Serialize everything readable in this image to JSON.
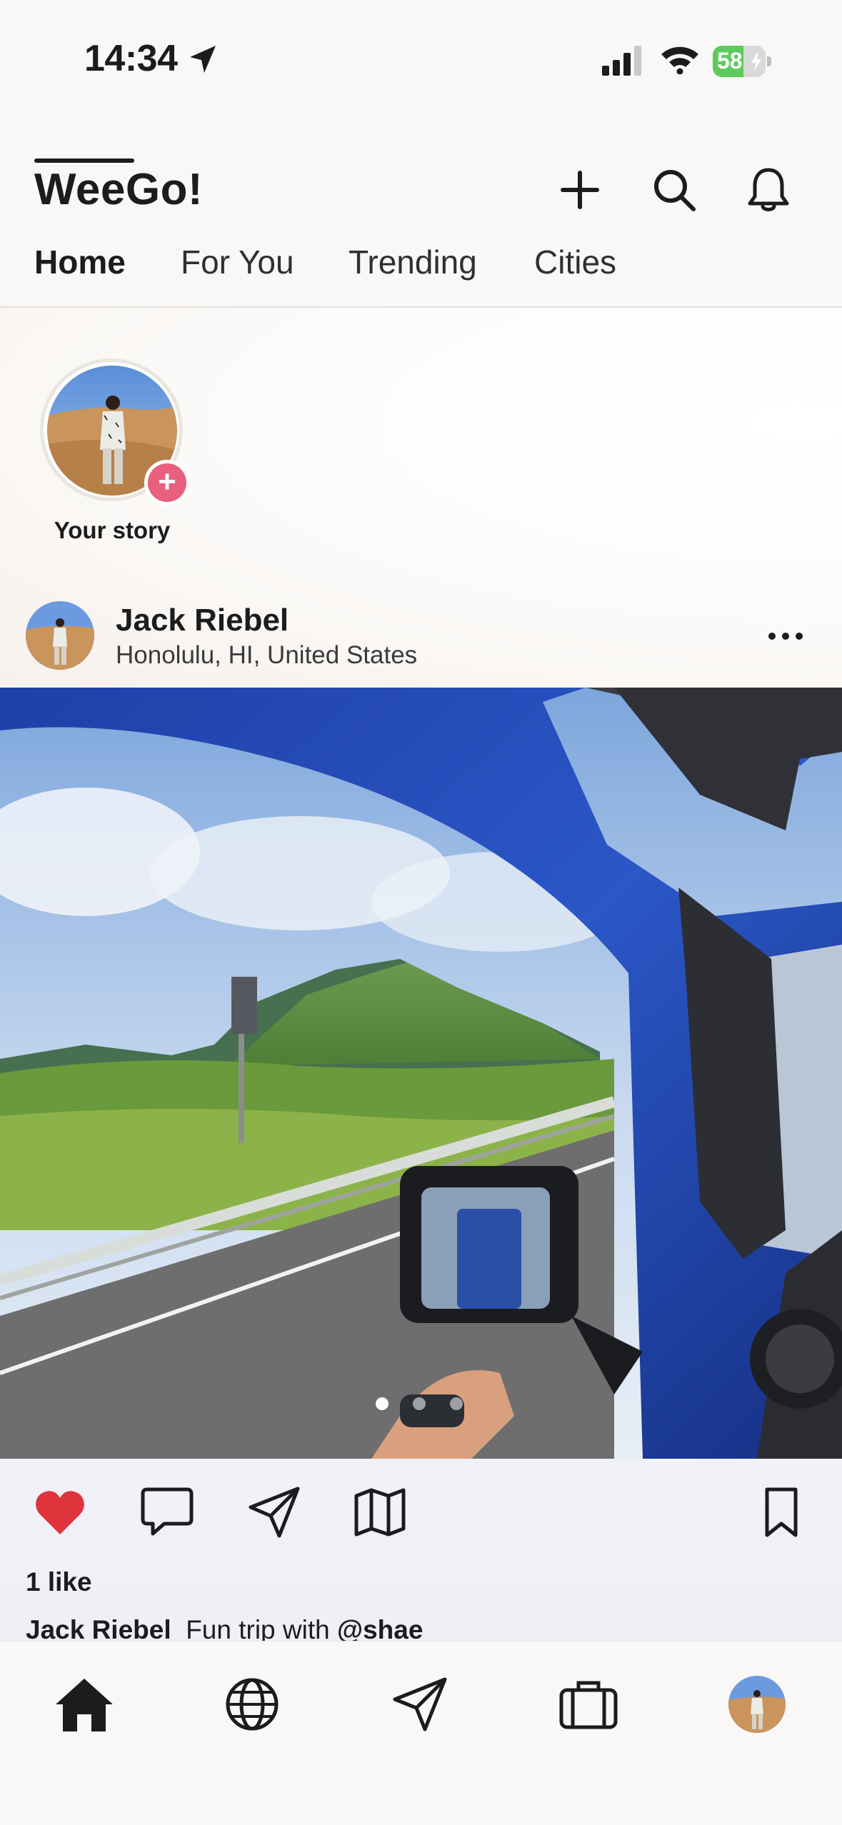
{
  "status_bar": {
    "time": "14:34",
    "battery_percent": "58",
    "battery_level": 0.58,
    "icons": [
      "location-arrow-icon",
      "signal-bars-icon",
      "wifi-icon",
      "battery-charging-icon"
    ]
  },
  "header": {
    "title": "WeeGo!",
    "icons": [
      "plus-icon",
      "search-icon",
      "bell-icon"
    ]
  },
  "tabs": [
    {
      "label": "Home",
      "active": true
    },
    {
      "label": "For You",
      "active": false
    },
    {
      "label": "Trending",
      "active": false
    },
    {
      "label": "Cities",
      "active": false
    }
  ],
  "story": {
    "label": "Your story",
    "add_symbol": "+"
  },
  "post": {
    "user": "Jack Riebel",
    "location": "Honolulu, HI, United States",
    "more_symbol": "•••",
    "image_count": 3,
    "current_image": 1,
    "likes_text": "1 like",
    "caption_user": "Jack Riebel",
    "caption_text": "Fun trip with",
    "caption_mention": "@shae"
  },
  "actions": [
    "heart-icon",
    "comment-icon",
    "share-icon",
    "map-icon",
    "bookmark-icon"
  ],
  "colors": {
    "accent_pink": "#e8607e",
    "heart_red": "#e0343c",
    "battery_green": "#5fca5c"
  },
  "tabbar": [
    "home-icon",
    "globe-icon",
    "send-icon",
    "briefcase-icon",
    "profile-avatar"
  ]
}
